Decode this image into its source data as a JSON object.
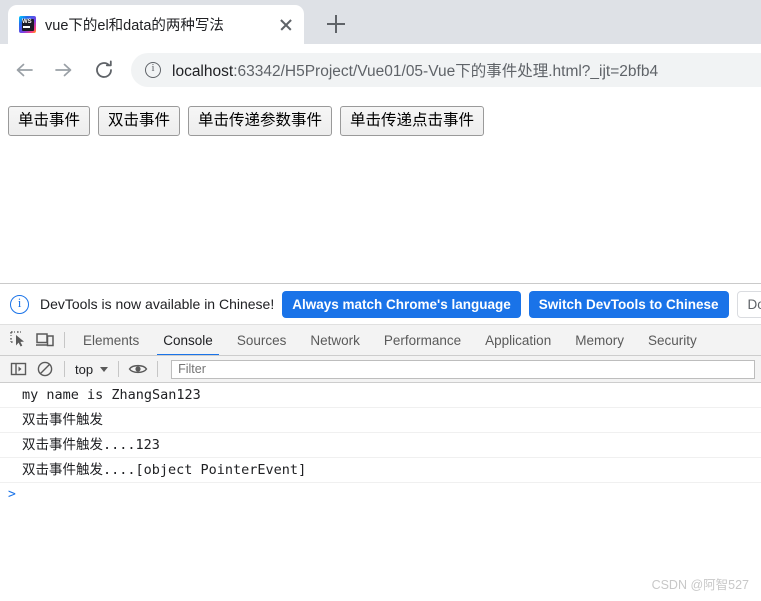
{
  "browser": {
    "tab": {
      "title": "vue下的el和data的两种写法",
      "favicon_name": "webstorm-icon",
      "favicon_text": "WS",
      "close_label": "×"
    },
    "new_tab_label": "+",
    "nav": {
      "back_label": "←",
      "forward_label": "→",
      "reload_label": "⟳"
    },
    "omnibox": {
      "security_icon": "info-circle-icon",
      "url_host": "localhost",
      "url_path": ":63342/H5Project/Vue01/05-Vue下的事件处理.html?_ijt=2bfb4"
    }
  },
  "page": {
    "buttons": [
      {
        "label": "单击事件"
      },
      {
        "label": "双击事件"
      },
      {
        "label": "单击传递参数事件"
      },
      {
        "label": "单击传递点击事件"
      }
    ]
  },
  "devtools": {
    "banner": {
      "icon": "info-circle-icon",
      "message": "DevTools is now available in Chinese!",
      "primary_button": "Always match Chrome's language",
      "secondary_button": "Switch DevTools to Chinese",
      "tertiary_button": "Don't show again"
    },
    "toolbar_icons": [
      {
        "name": "inspect-element-icon"
      },
      {
        "name": "device-toolbar-icon"
      }
    ],
    "tabs": [
      {
        "label": "Elements",
        "active": false
      },
      {
        "label": "Console",
        "active": true
      },
      {
        "label": "Sources",
        "active": false
      },
      {
        "label": "Network",
        "active": false
      },
      {
        "label": "Performance",
        "active": false
      },
      {
        "label": "Application",
        "active": false
      },
      {
        "label": "Memory",
        "active": false
      },
      {
        "label": "Security",
        "active": false
      }
    ],
    "console_toolbar": {
      "sidebar_icon": "console-sidebar-icon",
      "clear_icon": "clear-console-icon",
      "context_value": "top",
      "eye_icon": "live-expression-eye-icon",
      "filter_placeholder": "Filter",
      "filter_value": ""
    },
    "console_messages": [
      {
        "text": "my name is ZhangSan123"
      },
      {
        "text": "双击事件触发"
      },
      {
        "text": "双击事件触发....123"
      },
      {
        "text": "双击事件触发....[object PointerEvent]"
      }
    ],
    "prompt_symbol": ">"
  },
  "watermark": "CSDN @阿智527",
  "colors": {
    "accent_blue": "#1a73e8",
    "tabstrip_bg": "#dee1e6",
    "devtools_bg": "#f3f3f3"
  }
}
